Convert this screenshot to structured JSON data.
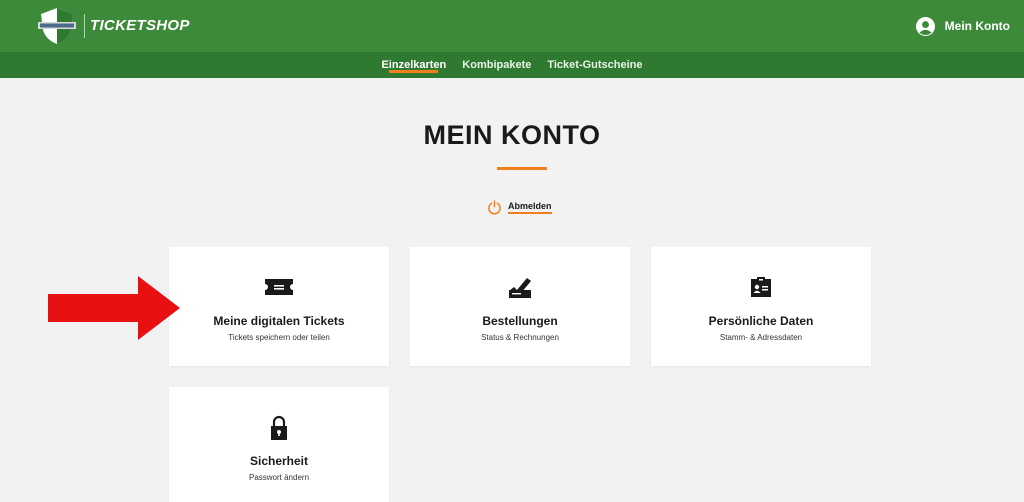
{
  "header": {
    "brand": "TICKETSHOP",
    "account_label": "Mein Konto"
  },
  "subnav": {
    "tabs": [
      {
        "label": "Einzelkarten",
        "active": true
      },
      {
        "label": "Kombipakete",
        "active": false
      },
      {
        "label": "Ticket-Gutscheine",
        "active": false
      }
    ]
  },
  "main": {
    "title": "MEIN KONTO",
    "logout_label": "Abmelden",
    "cards": [
      {
        "title": "Meine digitalen Tickets",
        "subtitle": "Tickets speichern oder teilen",
        "icon": "ticket-icon"
      },
      {
        "title": "Bestellungen",
        "subtitle": "Status & Rechnungen",
        "icon": "order-icon"
      },
      {
        "title": "Persönliche Daten",
        "subtitle": "Stamm- & Adressdaten",
        "icon": "id-card-icon"
      },
      {
        "title": "Sicherheit",
        "subtitle": "Passwort ändern",
        "icon": "lock-icon"
      }
    ]
  },
  "colors": {
    "header_green": "#3e8a3b",
    "subnav_green": "#2f7a30",
    "accent_orange": "#f07f1d",
    "annotation_red": "#e81010"
  }
}
